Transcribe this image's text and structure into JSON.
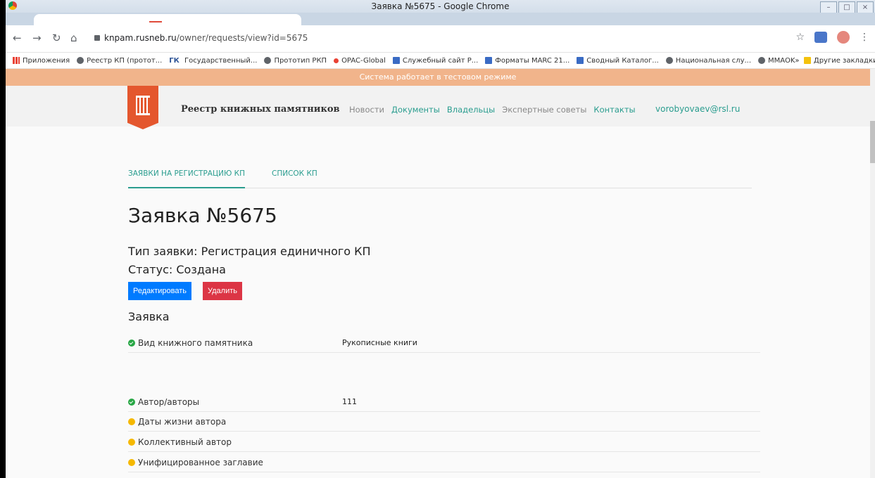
{
  "window": {
    "title": "Заявка №5675 - Google Chrome"
  },
  "address_bar": {
    "host": "knpam.rusneb.ru",
    "path": "/owner/requests/view?id=5675"
  },
  "bookmarks": [
    {
      "label": "Приложения",
      "icon": "apps-grid-icon"
    },
    {
      "label": "Реестр КП (протот...",
      "icon": "globe-icon"
    },
    {
      "label": "Государственный...",
      "icon": "gk-icon",
      "prefix": "ГК"
    },
    {
      "label": "Прототип РКП",
      "icon": "globe-icon"
    },
    {
      "label": "OPAC-Global",
      "icon": "opac-icon"
    },
    {
      "label": "Служебный сайт Р...",
      "icon": "rsl-icon"
    },
    {
      "label": "Форматы MARC 21...",
      "icon": "rsl-icon"
    },
    {
      "label": "Сводный Каталог...",
      "icon": "catalog-icon"
    },
    {
      "label": "Национальная слу...",
      "icon": "globe-icon"
    },
    {
      "label": "MMAOK",
      "icon": "globe-icon"
    }
  ],
  "bookmarks_more": "»",
  "other_bookmarks": "Другие закладки",
  "site": {
    "test_banner": "Система работает в тестовом режиме",
    "name": "Реестр книжных памятников",
    "nav": [
      {
        "label": "Новости",
        "active": false
      },
      {
        "label": "Документы",
        "active": true
      },
      {
        "label": "Владельцы",
        "active": true
      },
      {
        "label": "Экспертные советы",
        "active": false
      },
      {
        "label": "Контакты",
        "active": true
      }
    ],
    "user_email": "vorobyovaev@rsl.ru",
    "accent_color": "#2a9d8f",
    "brand_color": "#e4572e"
  },
  "tabs": [
    {
      "label": "ЗАЯВКИ НА РЕГИСТРАЦИЮ КП",
      "active": true
    },
    {
      "label": "СПИСОК КП",
      "active": false
    }
  ],
  "request": {
    "title": "Заявка №5675",
    "type": "Тип заявки: Регистрация единичного КП",
    "status": "Статус: Создана",
    "edit_label": "Редактировать",
    "delete_label": "Удалить",
    "section_title": "Заявка",
    "fields": [
      {
        "label": "Вид книжного памятника",
        "value": "Рукописные книги",
        "state": "complete"
      },
      {
        "label": "Автор/авторы",
        "value": "111",
        "state": "complete"
      },
      {
        "label": "Даты жизни автора",
        "value": "",
        "state": "pending"
      },
      {
        "label": "Коллективный автор",
        "value": "",
        "state": "pending"
      },
      {
        "label": "Унифицированное заглавие",
        "value": "",
        "state": "pending"
      }
    ]
  }
}
